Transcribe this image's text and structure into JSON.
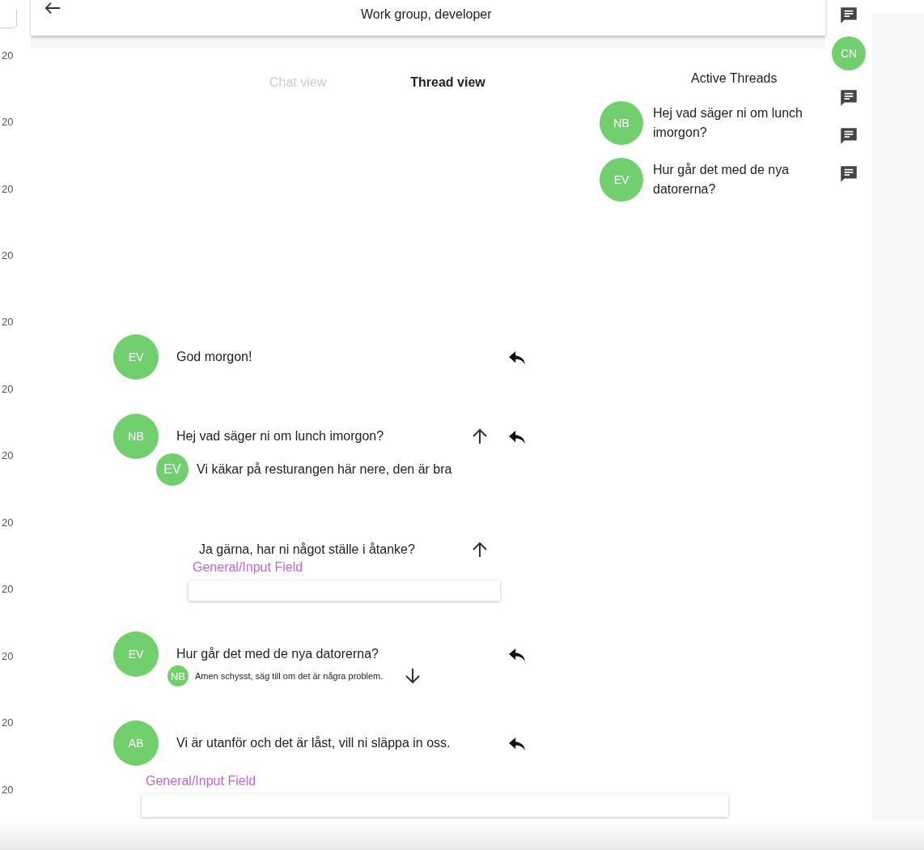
{
  "gutter_labels": [
    "20",
    "20",
    "20",
    "20",
    "20",
    "20",
    "20",
    "20",
    "20",
    "20",
    "20",
    "20"
  ],
  "header": {
    "title": "Work group, developer"
  },
  "tabs": [
    {
      "label": "Chat view",
      "selected": false
    },
    {
      "label": "Thread view",
      "selected": true
    }
  ],
  "active_threads": {
    "title": "Active Threads",
    "items": [
      {
        "initials": "NB",
        "text": "Hej vad säger ni om lunch imorgon?"
      },
      {
        "initials": "EV",
        "text": "Hur går det med de nya datorerna?"
      }
    ]
  },
  "rail": {
    "avatar": "CN"
  },
  "messages": [
    {
      "kind": "message",
      "initials": "EV",
      "text": "God morgon!"
    },
    {
      "kind": "message",
      "initials": "NB",
      "text": "Hej vad säger ni om lunch imorgon?",
      "expanded": true,
      "replies": [
        {
          "kind": "medium",
          "initials": "EV",
          "text": "Vi käkar på resturangen här nere, den är bra"
        }
      ]
    },
    {
      "kind": "draft",
      "text": "Ja gärna, har ni något ställe i åtanke?",
      "expanded": true,
      "label": "General/Input Field"
    },
    {
      "kind": "message",
      "initials": "EV",
      "text": "Hur går det med de nya datorerna?",
      "replies": [
        {
          "kind": "small",
          "initials": "NB",
          "text": "Amen schysst, säg till om det är några problem.",
          "expanded": false
        }
      ]
    },
    {
      "kind": "message",
      "initials": "AB",
      "text": "Vi är utanför och det är låst, vill ni släppa in oss."
    }
  ],
  "composer": {
    "label": "General/Input Field"
  }
}
